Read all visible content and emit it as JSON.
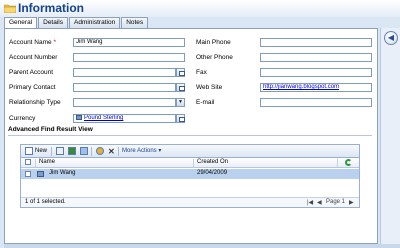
{
  "header": {
    "title": "Information"
  },
  "tabs": [
    {
      "label": "General",
      "active": true
    },
    {
      "label": "Details"
    },
    {
      "label": "Administration"
    },
    {
      "label": "Notes"
    }
  ],
  "form": {
    "left": [
      {
        "label": "Account Name",
        "required": "*",
        "value": "Jim Wang",
        "placeholder": ""
      },
      {
        "label": "Account Number",
        "value": ""
      },
      {
        "label": "Parent Account",
        "value": ""
      },
      {
        "label": "Primary Contact",
        "value": ""
      },
      {
        "label": "Relationship Type",
        "value": ""
      },
      {
        "label": "Currency",
        "value": "Pound Sterling"
      }
    ],
    "right": [
      {
        "label": "Main Phone",
        "value": ""
      },
      {
        "label": "Other Phone",
        "value": ""
      },
      {
        "label": "Fax",
        "value": ""
      },
      {
        "label": "Web Site",
        "value": "http://jianwang.blogspot.com"
      },
      {
        "label": "E-mail",
        "value": ""
      }
    ]
  },
  "section": {
    "title": "Advanced Find Result View"
  },
  "grid": {
    "toolbar": {
      "new_label": "New",
      "more_actions": "More Actions"
    },
    "columns": [
      "Name",
      "Created On"
    ],
    "rows": [
      {
        "name": "Jim Wang",
        "created_on": "29/04/2009"
      }
    ],
    "status": "1 of 1 selected.",
    "pager": "Page 1"
  },
  "colors": {
    "accent": "#15428b",
    "panel_bg": "#dbe6f4",
    "selected_row": "#b9d1ee"
  }
}
